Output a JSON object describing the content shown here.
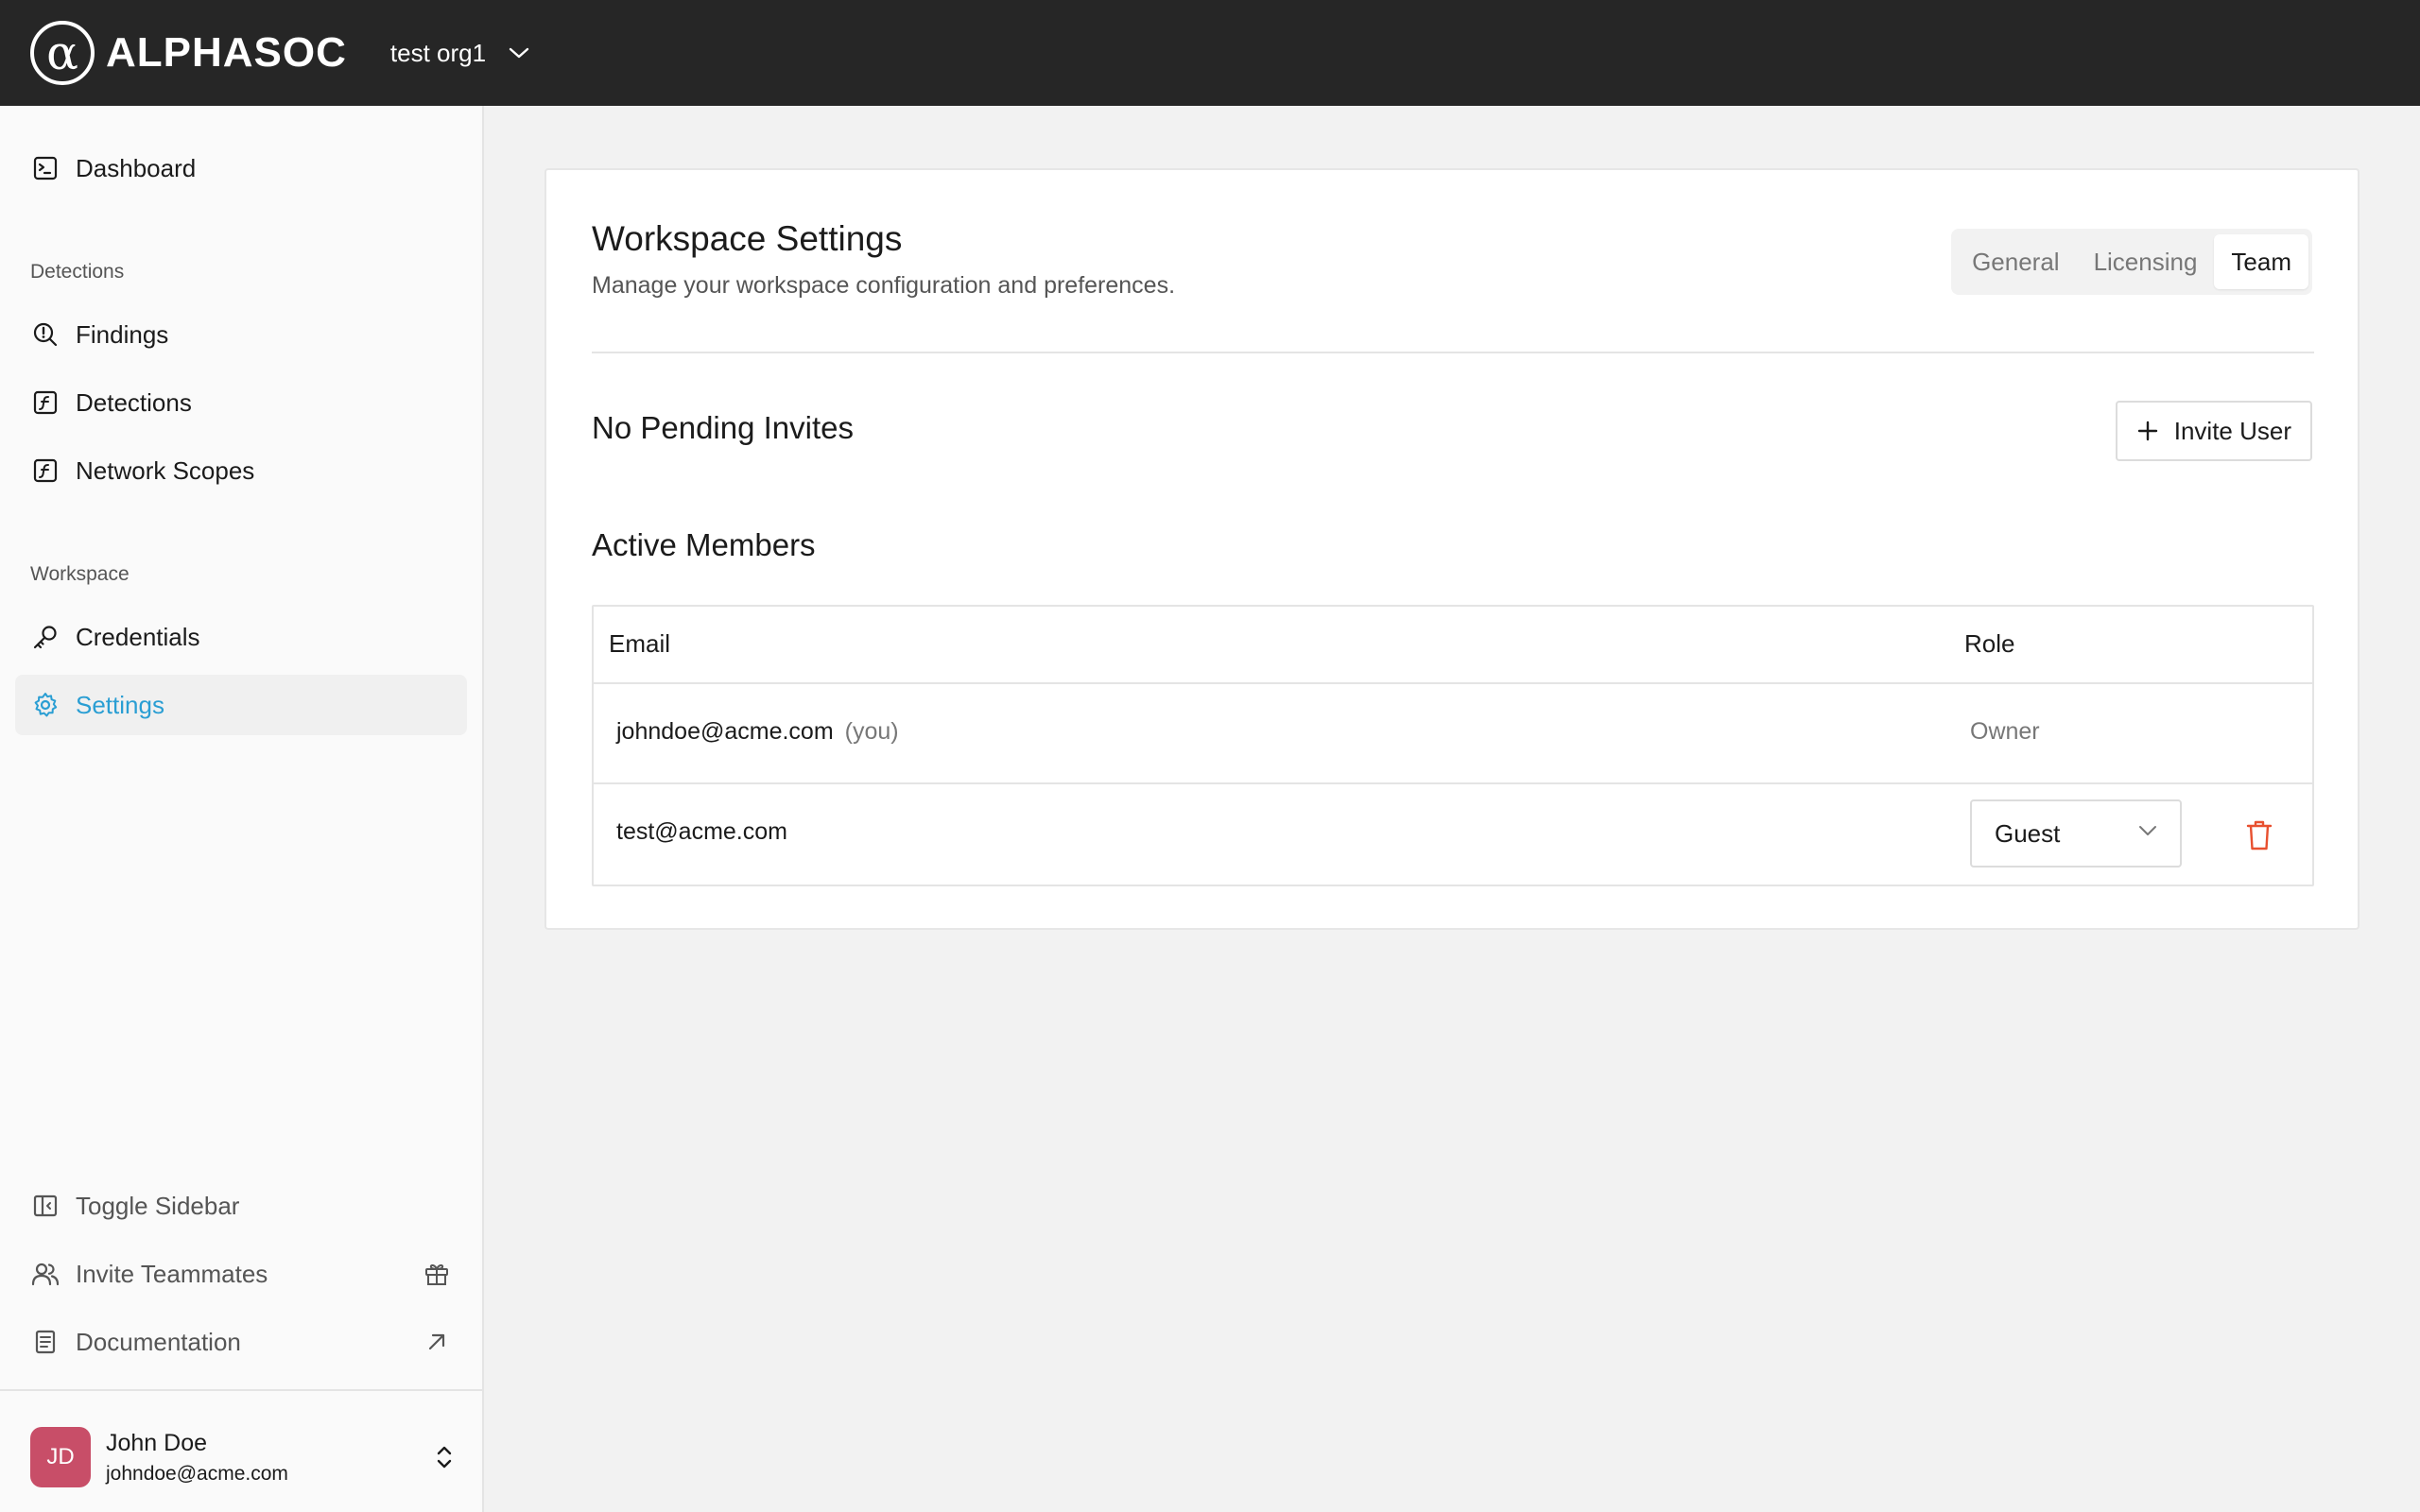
{
  "app": {
    "brand": "ALPHASOC",
    "logo_glyph": "α",
    "org_name": "test org1"
  },
  "sidebar": {
    "dashboard": "Dashboard",
    "section_detections": "Detections",
    "findings": "Findings",
    "detections": "Detections",
    "network_scopes": "Network Scopes",
    "section_workspace": "Workspace",
    "credentials": "Credentials",
    "settings": "Settings",
    "toggle_sidebar": "Toggle Sidebar",
    "invite_teammates": "Invite Teammates",
    "documentation": "Documentation",
    "active_item": "Settings"
  },
  "user": {
    "initials": "JD",
    "name": "John Doe",
    "email": "johndoe@acme.com",
    "avatar_color": "#c84e68"
  },
  "page": {
    "title": "Workspace Settings",
    "subtitle": "Manage your workspace configuration and preferences.",
    "tabs": [
      {
        "label": "General"
      },
      {
        "label": "Licensing"
      },
      {
        "label": "Team"
      }
    ],
    "active_tab": "Team",
    "pending_title": "No Pending Invites",
    "invite_button": "Invite User",
    "members_title": "Active Members"
  },
  "members_table": {
    "columns": [
      "Email",
      "Role"
    ],
    "rows": [
      {
        "email": "johndoe@acme.com",
        "you_tag": "(you)",
        "role": "Owner"
      },
      {
        "email": "test@acme.com",
        "role": "Guest"
      }
    ]
  },
  "colors": {
    "accent": "#2a9ed3",
    "topbar": "#262626",
    "danger": "#e8502f"
  }
}
